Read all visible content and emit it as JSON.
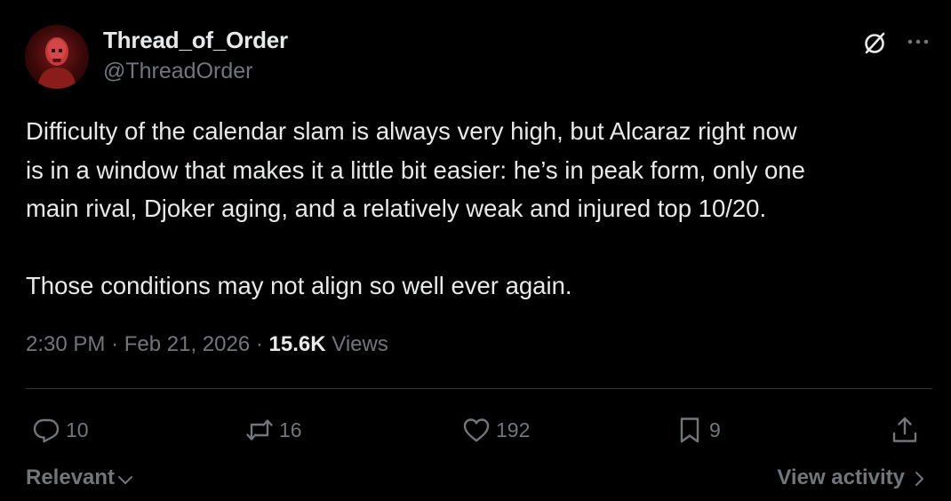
{
  "author": {
    "display_name": "Thread_of_Order",
    "handle": "@ThreadOrder",
    "avatar_icon": "avatar-red-skull"
  },
  "tweet": {
    "lines_paragraph_1": [
      "Difficulty of the calendar slam is always very high, but Alcaraz right now",
      "is in a window that makes it a little bit easier: he’s in peak form, only one",
      "main rival, Djoker aging, and a relatively weak and injured top 10/20."
    ],
    "paragraph_2": "Those conditions may not align so well ever again."
  },
  "meta": {
    "time": "2:30 PM",
    "separator": "·",
    "date": "Feb 21, 2026",
    "views_count": "15.6K",
    "views_label": "Views"
  },
  "actions": {
    "replies": "10",
    "reposts": "16",
    "likes": "192",
    "bookmarks": "9"
  },
  "footer": {
    "sort_label": "Relevant",
    "activity_label": "View activity"
  },
  "colors": {
    "background": "#000000",
    "primary_text": "#e7e9ea",
    "secondary_text": "#71767b",
    "divider": "#2f3336"
  }
}
